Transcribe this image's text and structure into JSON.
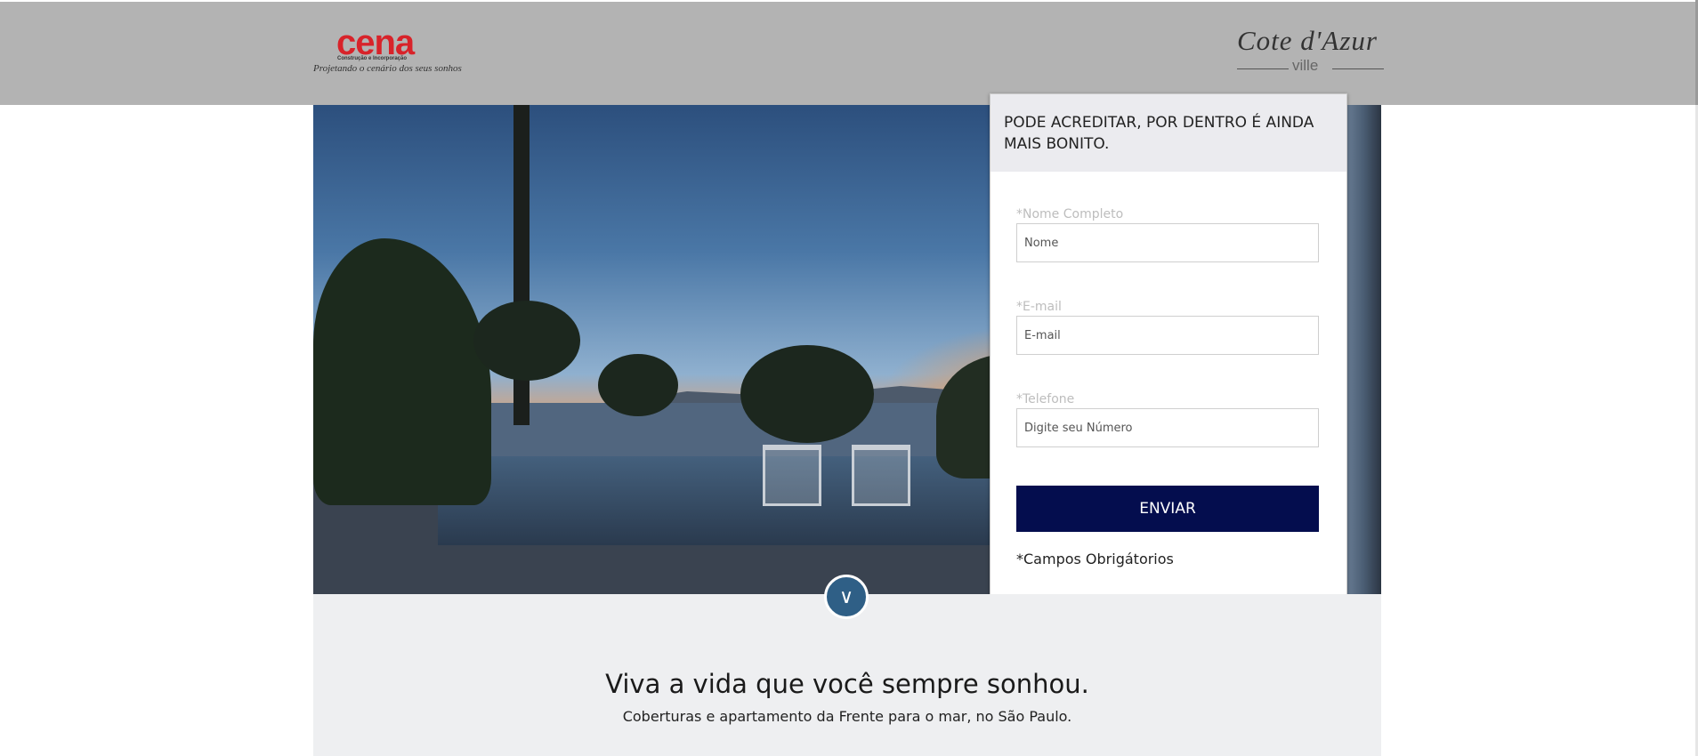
{
  "header": {
    "logo_left": {
      "brand": "cena",
      "subtitle": "Construção e Incorporação",
      "tagline": "Projetando o cenário dos seus sonhos"
    },
    "logo_right": {
      "script": "Cote d'Azur",
      "sub": "ville"
    },
    "background_color": "#b3b3b3"
  },
  "form": {
    "title": "PODE ACREDITAR, POR DENTRO É AINDA MAIS BONITO.",
    "fields": [
      {
        "label": "*Nome Completo",
        "placeholder": "Nome",
        "value": ""
      },
      {
        "label": "*E-mail",
        "placeholder": "E-mail",
        "value": ""
      },
      {
        "label": "*Telefone",
        "placeholder": "Digite seu Número",
        "value": ""
      }
    ],
    "submit_label": "ENVIAR",
    "required_note": "*Campos Obrigátorios",
    "button_color": "#040d4e"
  },
  "scroll_button": {
    "icon": "chevron-down-icon",
    "glyph": "∨",
    "color": "#2f5f86"
  },
  "intro": {
    "title": "Viva a vida que você sempre sonhou.",
    "subtitle": "Coberturas e apartamento da Frente para o mar, no São Paulo."
  }
}
